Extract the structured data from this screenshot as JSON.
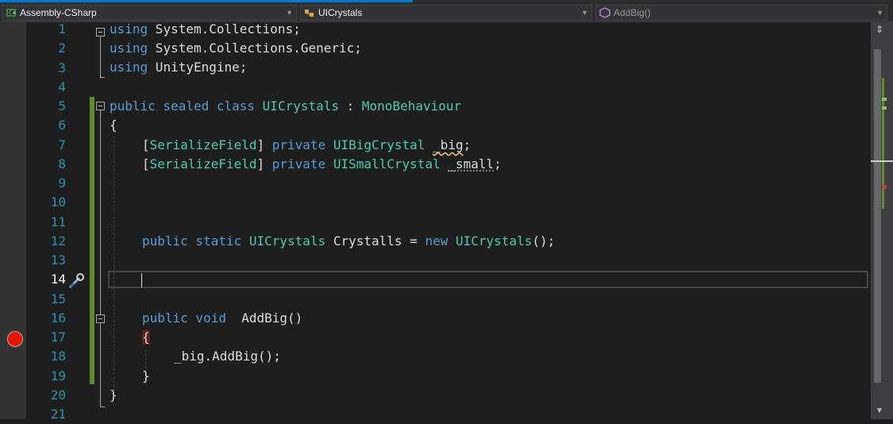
{
  "navbar": {
    "project": "Assembly-CSharp",
    "type": "UICrystals",
    "member": "AddBig()"
  },
  "line_numbers": [
    "1",
    "2",
    "3",
    "4",
    "5",
    "6",
    "7",
    "8",
    "9",
    "10",
    "11",
    "12",
    "13",
    "14",
    "15",
    "16",
    "17",
    "18",
    "19",
    "20",
    "21"
  ],
  "current_line": "14",
  "code": {
    "l1_kw": "using",
    "l1_rest": " System.Collections;",
    "l2_kw": "using",
    "l2_rest": " System.Collections.Generic;",
    "l3_kw": "using",
    "l3_rest": " UnityEngine;",
    "l5_mod": "public sealed class",
    "l5_name": "UIClassName",
    "l5_name_text": "UICrystals",
    "l5_colon": " : ",
    "l5_base": "MonoBehaviour",
    "l6_brace": "{",
    "l7_attr": "SerializeField",
    "l7_priv": "private",
    "l7_type": "UIBigCrystal",
    "l7_field": "_big",
    "l7_semi": ";",
    "l8_attr": "SerializeField",
    "l8_priv": "private",
    "l8_type": "UISmallCrystal",
    "l8_field": "_small",
    "l8_semi": ";",
    "l12_mods": "public static",
    "l12_type": "UICrystals",
    "l12_name": "Crystalls",
    "l12_eq": " = ",
    "l12_new": "new",
    "l12_ctor": "UICrystals",
    "l12_end": "();",
    "l16_mods": "public void",
    "l16_name": "AddBig()",
    "l17_brace": "{",
    "l18_call": "_big.AddBig();",
    "l19_brace": "}",
    "l20_brace": "}"
  },
  "colors": {
    "keyword": "#569cd6",
    "type": "#4ec9b0",
    "line_number": "#2b91af",
    "change_bar": "#608930",
    "breakpoint": "#e51400"
  },
  "icons": {
    "project": "csharp-project-icon",
    "type": "class-icon",
    "member": "method-icon",
    "quick_action": "screwdriver-wrench-icon",
    "breakpoint": "breakpoint-icon"
  }
}
